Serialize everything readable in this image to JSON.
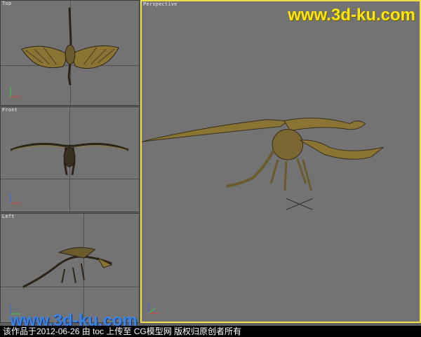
{
  "watermark": {
    "top_text": "www.3d-ku.com",
    "bottom_text": "www.3d-ku.com"
  },
  "viewports": {
    "top": {
      "label": "Top"
    },
    "front": {
      "label": "Front"
    },
    "left": {
      "label": "Left"
    },
    "perspective": {
      "label": "Perspective"
    }
  },
  "caption": {
    "text": "该作品于2012-06-26 由 toc 上传至 CG模型网   版权归原创者所有"
  },
  "colors": {
    "active_border": "#f2df4a",
    "viewport_bg": "#737373",
    "model": "#8a7434",
    "watermark_yellow": "#ffe60a",
    "watermark_blue": "#3a82e8"
  },
  "icons": {
    "axis_gizmo": "axis-tripod-icon"
  }
}
